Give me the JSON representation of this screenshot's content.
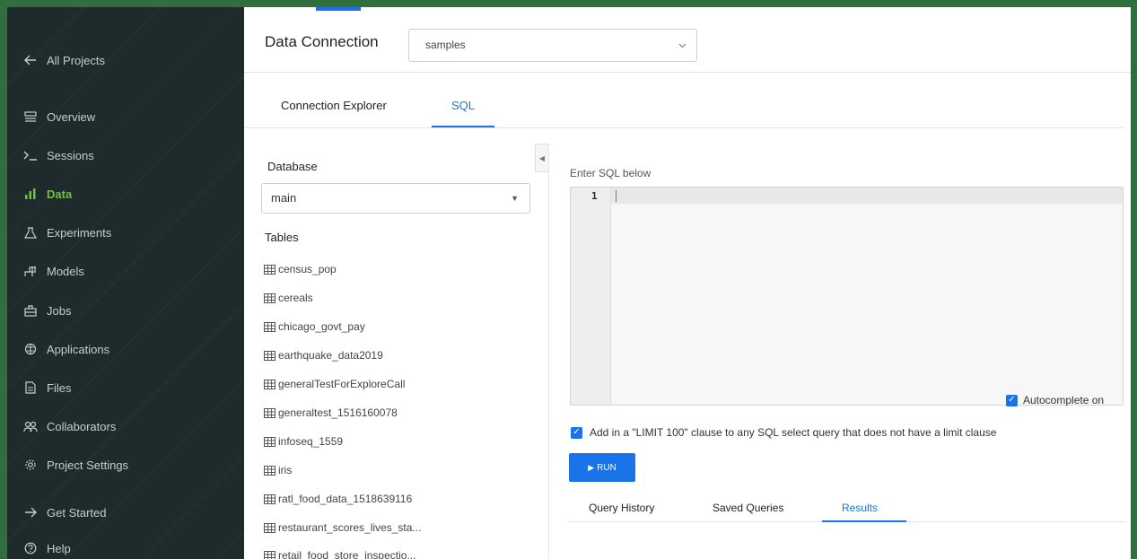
{
  "sidebar": {
    "back": {
      "label": "All Projects",
      "icon": "arrow-left-icon"
    },
    "items": [
      {
        "label": "Overview",
        "icon": "overview-icon"
      },
      {
        "label": "Sessions",
        "icon": "terminal-icon"
      },
      {
        "label": "Data",
        "icon": "bar-chart-icon",
        "active": true
      },
      {
        "label": "Experiments",
        "icon": "flask-icon"
      },
      {
        "label": "Models",
        "icon": "models-icon"
      },
      {
        "label": "Jobs",
        "icon": "jobs-icon"
      },
      {
        "label": "Applications",
        "icon": "applications-icon"
      },
      {
        "label": "Files",
        "icon": "file-icon"
      },
      {
        "label": "Collaborators",
        "icon": "collaborators-icon"
      },
      {
        "label": "Project Settings",
        "icon": "gear-icon"
      }
    ],
    "bottom": [
      {
        "label": "Get Started",
        "icon": "arrow-right-icon"
      },
      {
        "label": "Help",
        "icon": "help-icon"
      }
    ]
  },
  "header": {
    "connection_label": "Data Connection",
    "connection_value": "samples"
  },
  "tabs": [
    {
      "label": "Connection Explorer",
      "active": false
    },
    {
      "label": "SQL",
      "active": true
    }
  ],
  "left_panel": {
    "database_label": "Database",
    "database_value": "main",
    "tables_label": "Tables",
    "tables": [
      "census_pop",
      "cereals",
      "chicago_govt_pay",
      "earthquake_data2019",
      "generalTestForExploreCall",
      "generaltest_1516160078",
      "infoseq_1559",
      "iris",
      "ratl_food_data_1518639116",
      "restaurant_scores_lives_sta...",
      "retail_food_store_inspectio..."
    ]
  },
  "editor": {
    "label": "Enter SQL below",
    "line_number": "1"
  },
  "options": {
    "autocomplete_label": "Autocomplete on",
    "limit_label": "Add in a \"LIMIT 100\" clause to any SQL select query that does not have a limit clause",
    "run_label": "RUN"
  },
  "bottom_tabs": [
    {
      "label": "Query History",
      "active": false
    },
    {
      "label": "Saved Queries",
      "active": false
    },
    {
      "label": "Results",
      "active": true
    }
  ],
  "colors": {
    "sidebar_bg": "#1f2a2c",
    "accent": "#1a73e8",
    "active_nav": "#6cc04a",
    "frame_border": "#2f6f3e"
  }
}
